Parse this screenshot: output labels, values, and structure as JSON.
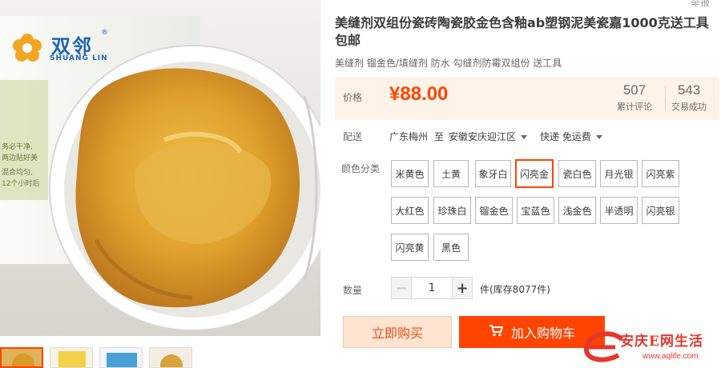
{
  "brand": {
    "name_cn": "双邻",
    "name_en": "SHUANG LIN",
    "registered": "®"
  },
  "product": {
    "title": "美缝剂双组份瓷砖陶瓷胶金色含釉ab塑钢泥美瓷嘉1000克送工具包邮",
    "subtitle": "美缝剂 镏金色/填缝剂 防水 勾缝剂防霉双组份 送工具",
    "report": "举报"
  },
  "price": {
    "label": "价格",
    "value": "¥88.00"
  },
  "stats": [
    {
      "num": "507",
      "label": "累计评论"
    },
    {
      "num": "543",
      "label": "交易成功"
    }
  ],
  "shipping": {
    "label": "配送",
    "origin": "广东梅州",
    "to": "至",
    "destination": "安徽安庆迎江区",
    "method": "快递 免运费"
  },
  "color": {
    "label": "颜色分类",
    "selected": "闪亮金",
    "options": [
      "米黄色",
      "土黄",
      "象牙白",
      "闪亮金",
      "瓷白色",
      "月光银",
      "闪亮紫",
      "大红色",
      "珍珠白",
      "镏金色",
      "宝蓝色",
      "浅金色",
      "半透明",
      "闪亮银",
      "闪亮黄",
      "黑色"
    ]
  },
  "quantity": {
    "label": "数量",
    "value": "1",
    "minus": "−",
    "plus": "+",
    "stock": "件(库存8077件)"
  },
  "actions": {
    "buy_now": "立即购买",
    "add_to_cart": "加入购物车"
  },
  "watermark": {
    "text": "安庆E网生活",
    "url": "www.aqlife.com"
  },
  "colors": {
    "accent": "#ff4400",
    "price_bg": "#fff2e8",
    "brand_blue": "#1d63b8",
    "gold": "#d9a532"
  },
  "icons": {
    "cart": "cart-icon",
    "caret": "caret-down-icon",
    "logo": "flower-logo-icon"
  }
}
